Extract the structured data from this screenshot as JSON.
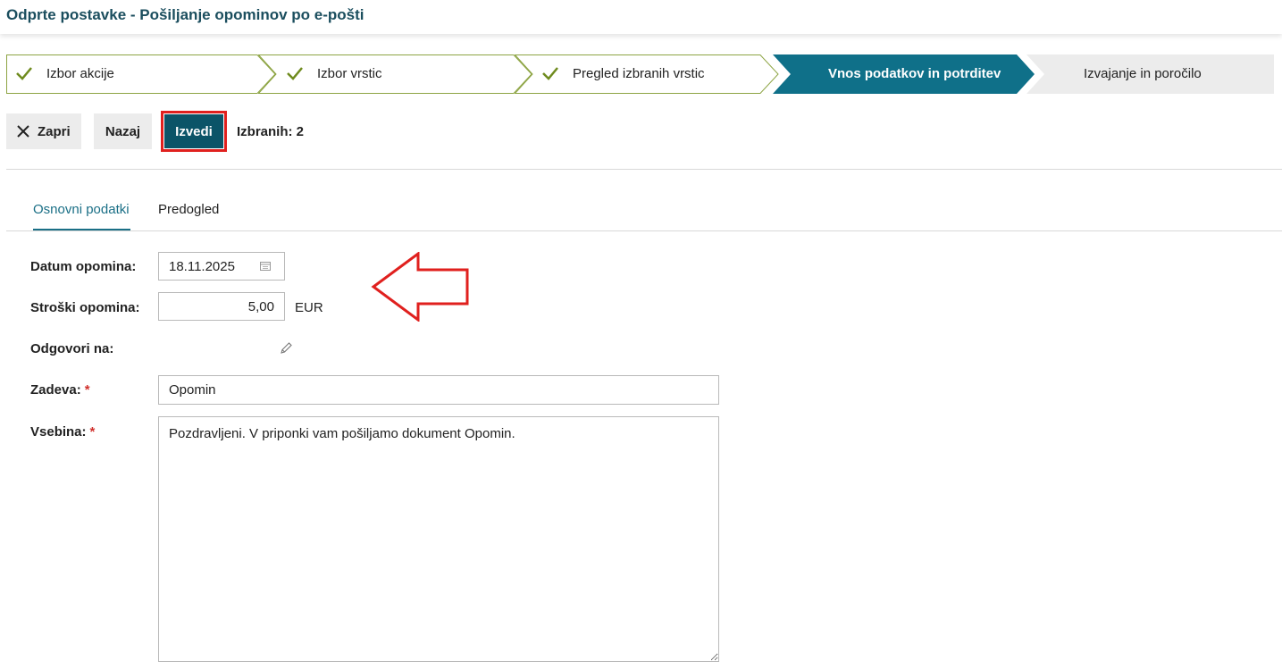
{
  "header": {
    "title": "Odprte postavke - Pošiljanje opominov po e-pošti"
  },
  "wizard": {
    "steps": [
      {
        "label": "Izbor akcije",
        "state": "done"
      },
      {
        "label": "Izbor vrstic",
        "state": "done"
      },
      {
        "label": "Pregled izbranih vrstic",
        "state": "done"
      },
      {
        "label": "Vnos podatkov in potrditev",
        "state": "active"
      },
      {
        "label": "Izvajanje in poročilo",
        "state": "pending"
      }
    ]
  },
  "toolbar": {
    "close_label": "Zapri",
    "back_label": "Nazaj",
    "run_label": "Izvedi",
    "selected_label": "Izbranih: 2"
  },
  "tabs": {
    "basic": "Osnovni podatki",
    "preview": "Predogled"
  },
  "form": {
    "date_label": "Datum opomina:",
    "date_value": "18.11.2025",
    "cost_label": "Stroški opomina:",
    "cost_value": "5,00",
    "currency": "EUR",
    "reply_label": "Odgovori na:",
    "subject_label": "Zadeva:",
    "subject_value": "Opomin",
    "body_label": "Vsebina:",
    "body_value": "Pozdravljeni. V priponki vam pošiljamo dokument Opomin.",
    "required_mark": "*"
  },
  "colors": {
    "accent": "#0b5468",
    "active_step": "#0f7089",
    "done_check": "#6f8b1e",
    "highlight": "#e0201e"
  },
  "icons": [
    "check-icon",
    "close-icon",
    "calendar-icon",
    "pencil-icon",
    "arrow-annotation"
  ]
}
